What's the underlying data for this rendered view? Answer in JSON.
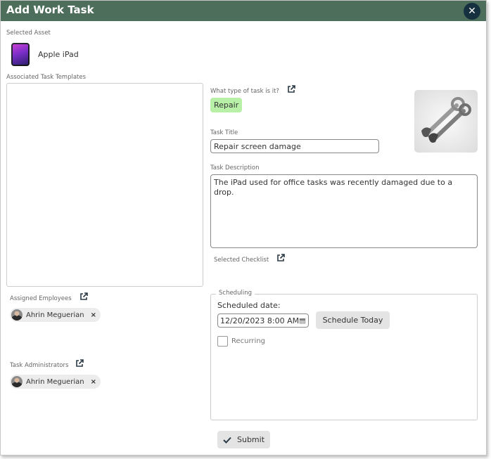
{
  "dialog": {
    "title": "Add Work Task",
    "close_icon": "close-icon"
  },
  "asset": {
    "label": "Selected Asset",
    "name": "Apple iPad",
    "icon": "ipad-icon"
  },
  "templates": {
    "label": "Associated Task Templates"
  },
  "task_type": {
    "label": "What type of task is it?",
    "value": "Repair",
    "chip_color": "#b8f0a8",
    "image_icon": "wrench-icon"
  },
  "task_title": {
    "label": "Task Title",
    "value": "Repair screen damage"
  },
  "task_description": {
    "label": "Task Description",
    "value": "The iPad used for office tasks was recently damaged due to a drop."
  },
  "checklist": {
    "label": "Selected Checklist"
  },
  "assigned_employees": {
    "label": "Assigned Employees",
    "people": [
      {
        "name": "Ahrin Meguerian"
      }
    ]
  },
  "task_administrators": {
    "label": "Task Administrators",
    "people": [
      {
        "name": "Ahrin Meguerian"
      }
    ]
  },
  "scheduling": {
    "legend": "Scheduling",
    "date_label": "Scheduled date:",
    "date_value": "12/20/2023 8:00 AM",
    "today_button": "Schedule Today",
    "recurring_label": "Recurring",
    "recurring_checked": false
  },
  "submit": {
    "label": "Submit"
  },
  "colors": {
    "titlebar": "#4d6e5a",
    "close_button": "#16303f"
  }
}
